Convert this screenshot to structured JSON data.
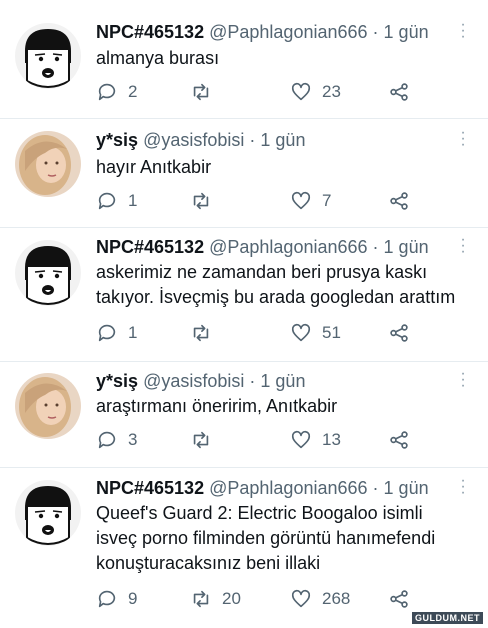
{
  "tweets": [
    {
      "name": "NPC#465132",
      "handle": "@Paphlagonian666",
      "separator": "·",
      "time": "1 gün",
      "avatar": "npc-wojak-avatar",
      "text": "almanya burası",
      "text_lines": [
        "almanya burası"
      ],
      "replies": "2",
      "retweets": "",
      "likes": "23"
    },
    {
      "name": "y*siş",
      "handle": "@yasisfobisi",
      "separator": "·",
      "time": "1 gün",
      "avatar": "blonde-girl-avatar",
      "text_lines": [
        "hayır Anıtkabir"
      ],
      "replies": "1",
      "retweets": "",
      "likes": "7"
    },
    {
      "name": "NPC#465132",
      "handle": "@Paphlagonian666",
      "separator": "·",
      "time": "1 gün",
      "avatar": "npc-wojak-avatar",
      "text_lines": [
        "askerimiz ne zamandan beri prusya kaskı",
        "takıyor. İsveçmiş bu arada googledan arattım"
      ],
      "replies": "1",
      "retweets": "",
      "likes": "51"
    },
    {
      "name": "y*siş",
      "handle": "@yasisfobisi",
      "separator": "·",
      "time": "1 gün",
      "avatar": "blonde-girl-avatar",
      "text_lines": [
        "araştırmanı öneririm, Anıtkabir"
      ],
      "replies": "3",
      "retweets": "",
      "likes": "13"
    },
    {
      "name": "NPC#465132",
      "handle": "@Paphlagonian666",
      "separator": "·",
      "time": "1 gün",
      "avatar": "npc-wojak-avatar",
      "text_lines": [
        "Queef's Guard 2: Electric Boogaloo isimli",
        "isveç porno filminden görüntü hanımefendi",
        "konuşturacaksınız beni illaki"
      ],
      "replies": "9",
      "retweets": "20",
      "likes": "268"
    }
  ],
  "watermark": "GULDUM.NET",
  "colors": {
    "text": "#0f1419",
    "secondary": "#536471",
    "divider": "#e6ecf0"
  }
}
